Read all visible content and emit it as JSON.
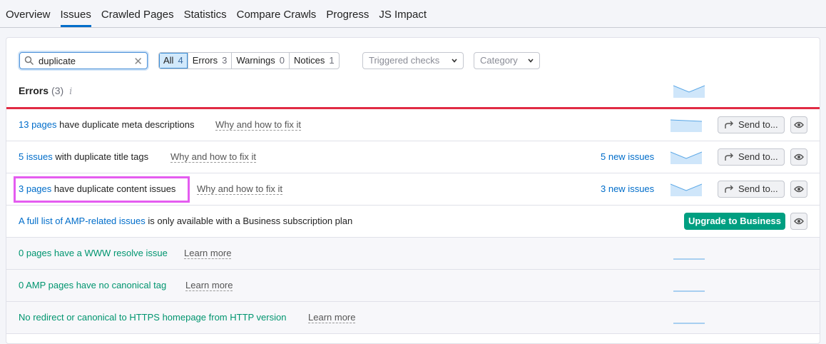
{
  "tabs": [
    "Overview",
    "Issues",
    "Crawled Pages",
    "Statistics",
    "Compare Crawls",
    "Progress",
    "JS Impact"
  ],
  "active_tab": "Issues",
  "search": {
    "value": "duplicate"
  },
  "segments": [
    {
      "label": "All",
      "count": "4"
    },
    {
      "label": "Errors",
      "count": "3"
    },
    {
      "label": "Warnings",
      "count": "0"
    },
    {
      "label": "Notices",
      "count": "1"
    }
  ],
  "dropdowns": {
    "triggered": "Triggered checks",
    "category": "Category"
  },
  "errors": {
    "title": "Errors",
    "count": "(3)",
    "info": "i"
  },
  "rows": {
    "r1": {
      "link": "13 pages",
      "text": " have duplicate meta descriptions",
      "why": "Why and how to fix it",
      "send": "Send to..."
    },
    "r2": {
      "link": "5 issues",
      "text": " with duplicate title tags",
      "why": "Why and how to fix it",
      "new": "5 new issues",
      "send": "Send to..."
    },
    "r3": {
      "link": "3 pages",
      "text": " have duplicate content issues",
      "why": "Why and how to fix it",
      "new": "3 new issues",
      "send": "Send to..."
    },
    "r4": {
      "link": "A full list of AMP-related issues",
      "text": " is only available with a Business subscription plan",
      "button": "Upgrade to Business"
    },
    "r5": {
      "text": "0 pages have a WWW resolve issue",
      "learn": "Learn more"
    },
    "r6": {
      "text": "0 AMP pages have no canonical tag",
      "learn": "Learn more"
    },
    "r7": {
      "text": "No redirect or canonical to HTTPS homepage from HTTP version",
      "learn": "Learn more"
    }
  },
  "colors": {
    "accent": "#006dca",
    "error": "#e12b44",
    "success": "#00956f",
    "upgrade": "#009f81",
    "highlight": "#e45cf0"
  }
}
